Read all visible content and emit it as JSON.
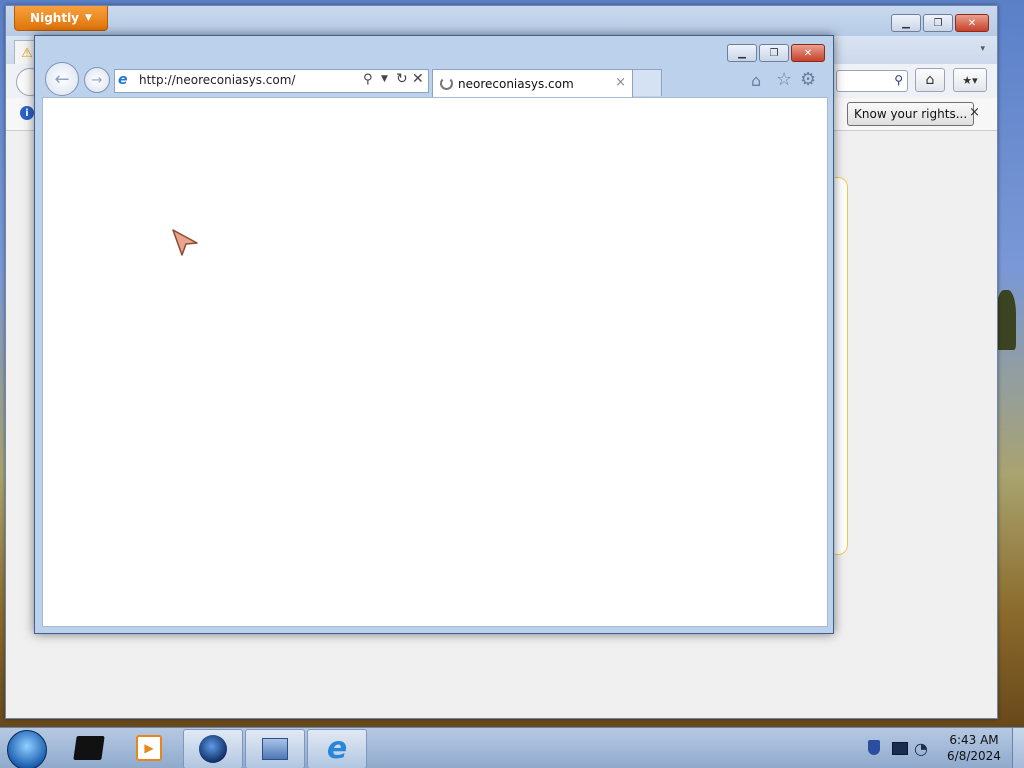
{
  "firefox": {
    "menu_button": "Nightly",
    "menu_arrow": "▼",
    "notification": {
      "action_button": "Know your rights...",
      "close": "×"
    }
  },
  "ie": {
    "address_url": "http://neoreconiasys.com/",
    "tab_title": "neoreconiasys.com",
    "tab_close": "×",
    "state": "loading"
  },
  "taskbar": {
    "clock_time": "6:43 AM",
    "clock_date": "6/8/2024"
  },
  "icons": {
    "warning": "warning-icon",
    "info": "info-icon",
    "home": "home-icon",
    "favorites": "star-icon",
    "tools": "gear-icon",
    "refresh": "refresh-icon",
    "stop": "stop-icon",
    "search": "search-icon"
  },
  "colors": {
    "nightly_orange": "#e0740a",
    "close_red": "#c7412a",
    "ie_frame": "#bcd2ec",
    "notification_border": "#f2c94c"
  }
}
